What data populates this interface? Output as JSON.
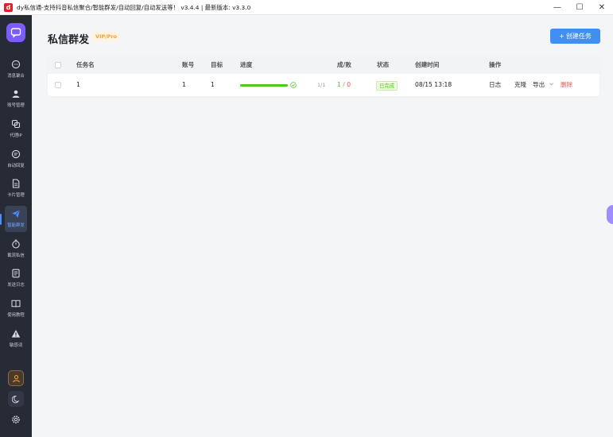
{
  "window": {
    "title": "dy私信通-支持抖音私信聚合/智能群发/自动回复/自动发送等！ v3.4.4 | 最新版本: v3.3.0",
    "logo_letter": "d",
    "controls": {
      "minimize": "—",
      "maximize": "☐",
      "close": "✕"
    }
  },
  "sidebar": {
    "items": [
      {
        "label": "消息聚合",
        "icon": "chat-bubble-icon"
      },
      {
        "label": "账号管理",
        "icon": "user-icon"
      },
      {
        "label": "代理IP",
        "icon": "link-icon"
      },
      {
        "label": "自动回复",
        "icon": "message-icon"
      },
      {
        "label": "卡片管理",
        "icon": "document-icon"
      },
      {
        "label": "智能群发",
        "icon": "send-icon",
        "active": true
      },
      {
        "label": "截流私信",
        "icon": "timer-icon"
      },
      {
        "label": "发送日志",
        "icon": "log-icon"
      },
      {
        "label": "使用教程",
        "icon": "book-icon"
      },
      {
        "label": "敏感词",
        "icon": "warning-icon"
      }
    ]
  },
  "page": {
    "title": "私信群发",
    "badge": "VIP/Pro",
    "create_button": "创建任务",
    "create_icon": "+"
  },
  "table": {
    "headers": {
      "name": "任务名",
      "account": "账号",
      "target": "目标",
      "progress": "进度",
      "success_fail": "成/败",
      "status": "状态",
      "created": "创建时间",
      "actions": "操作"
    },
    "rows": [
      {
        "name": "1",
        "account": "1",
        "target": "1",
        "progress_fraction": 1.0,
        "progress_text": "1/1",
        "success": "1",
        "separator": "/",
        "fail": "0",
        "status": "已完成",
        "created": "08/15 13:18",
        "actions": {
          "log": "日志",
          "clone": "克隆",
          "export": "导出",
          "delete": "删除"
        }
      }
    ]
  },
  "colors": {
    "accent": "#3f8ff5",
    "sidebar_bg": "#262b35",
    "brand": "#7b5cff",
    "success": "#52c41a",
    "danger": "#ff4d4f",
    "badge": "#f0a33a"
  }
}
